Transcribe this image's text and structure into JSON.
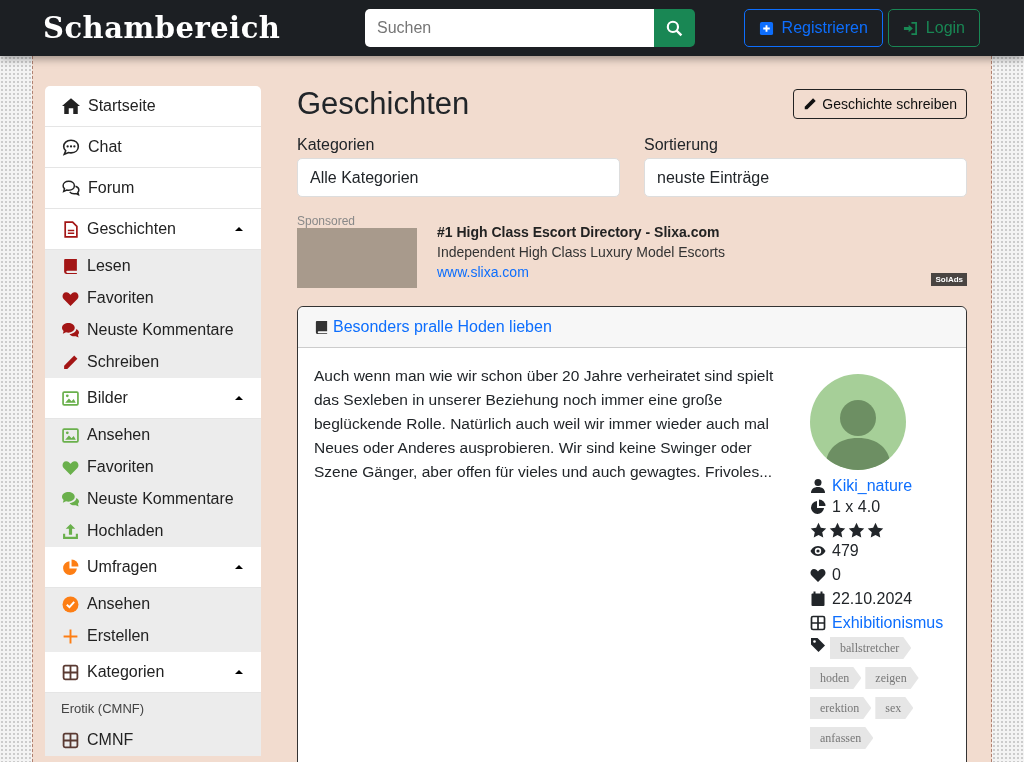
{
  "header": {
    "logo": "Schambereich",
    "search": {
      "placeholder": "Suchen"
    },
    "buttons": [
      {
        "label": "Registrieren",
        "kind": "register"
      },
      {
        "label": "Login",
        "kind": "login"
      }
    ]
  },
  "sidebar": {
    "items": [
      {
        "kind": "link",
        "label": "Startseite"
      },
      {
        "kind": "link",
        "label": "Chat"
      },
      {
        "kind": "link",
        "label": "Forum"
      },
      {
        "kind": "group",
        "label": "Geschichten",
        "color": "#a31515",
        "expanded": true,
        "children": [
          {
            "kind": "link",
            "label": "Lesen"
          },
          {
            "kind": "link",
            "label": "Favoriten"
          },
          {
            "kind": "link",
            "label": "Neuste Kommentare"
          },
          {
            "kind": "link",
            "label": "Schreiben"
          }
        ]
      },
      {
        "kind": "group",
        "label": "Bilder",
        "color": "#6ab04c",
        "expanded": true,
        "children": [
          {
            "kind": "link",
            "label": "Ansehen"
          },
          {
            "kind": "link",
            "label": "Favoriten"
          },
          {
            "kind": "link",
            "label": "Neuste Kommentare"
          },
          {
            "kind": "link",
            "label": "Hochladen"
          }
        ]
      },
      {
        "kind": "group",
        "label": "Umfragen",
        "color": "#fd7e14",
        "expanded": true,
        "children": [
          {
            "kind": "link",
            "label": "Ansehen"
          },
          {
            "kind": "link",
            "label": "Erstellen"
          }
        ]
      },
      {
        "kind": "group",
        "label": "Kategorien",
        "color": "#5a3a32",
        "expanded": true,
        "children": [
          {
            "kind": "heading",
            "label": "Erotik (CMNF)"
          },
          {
            "kind": "link",
            "label": "CMNF"
          }
        ]
      }
    ]
  },
  "main": {
    "title": "Geschichten",
    "write_button": "Geschichte schreiben",
    "filters": [
      {
        "label": "Kategorien",
        "value": "Alle Kategorien"
      },
      {
        "label": "Sortierung",
        "value": "neuste Einträge"
      }
    ],
    "ad": {
      "sponsored": "Sponsored",
      "title": "#1 High Class Escort Directory - Slixa.com",
      "description": "Independent High Class Luxury Model Escorts",
      "url": "www.slixa.com",
      "badge": "SolAds"
    },
    "story": {
      "title": "Besonders pralle Hoden lieben",
      "text": "Auch wenn man wie wir schon über 20 Jahre verheiratet sind spielt das Sexleben in unserer Beziehung noch immer eine große beglückende Rolle. Natürlich auch weil wir immer wieder auch mal Neues oder Anderes ausprobieren. Wir sind keine Swinger oder Szene Gänger, aber offen für vieles und auch gewagtes. Frivoles...",
      "author": "Kiki_nature",
      "rating": "1 x 4.0",
      "stars": 4,
      "views": "479",
      "likes": "0",
      "date": "22.10.2024",
      "category": "Exhibitionismus",
      "tags": [
        "ballstretcher",
        "hoden",
        "zeigen",
        "erektion",
        "sex",
        "anfassen"
      ]
    }
  }
}
